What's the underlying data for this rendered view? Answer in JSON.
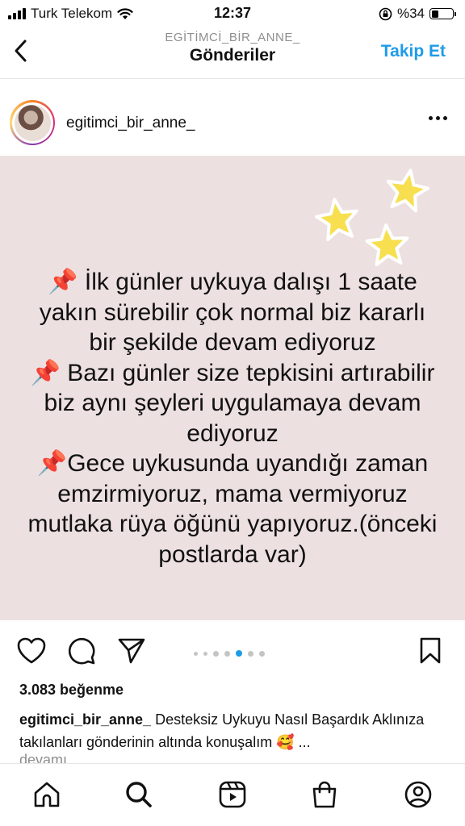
{
  "status_bar": {
    "carrier": "Turk Telekom",
    "time": "12:37",
    "battery": "%34",
    "battery_level": 0.34
  },
  "header": {
    "account": "EGİTİMCİ_BİR_ANNE_",
    "title": "Gönderiler",
    "follow_label": "Takip Et"
  },
  "post": {
    "username": "egitimci_bir_anne_",
    "text_lines": [
      "📌 İlk günler uykuya dalışı 1 saate",
      "yakın sürebilir çok normal biz kararlı",
      "bir şekilde devam ediyoruz",
      "📌 Bazı günler size tepkisini artırabilir",
      "biz aynı şeyleri uygulamaya devam",
      "ediyoruz",
      "📌Gece uykusunda uyandığı zaman",
      "emzirmiyoruz, mama vermiyoruz",
      "mutlaka rüya öğünü yapıyoruz.(önceki",
      "postlarda var)"
    ],
    "carousel": {
      "count": 7,
      "active_index": 4
    },
    "likes": "3.083 beğenme",
    "caption_user": "egitimci_bir_anne_",
    "caption_text": " Desteksiz Uykuyu Nasıl Başardık Aklınıza takılanları gönderinin altında konuşalım 🥰 ...",
    "more_label": "devamı"
  },
  "icons": {
    "back": "chevron-left-icon",
    "more": "more-horizontal-icon",
    "like": "heart-icon",
    "comment": "comment-icon",
    "share": "send-icon",
    "save": "bookmark-icon",
    "tabs": [
      "home-icon",
      "search-icon",
      "reels-icon",
      "shop-icon",
      "profile-icon"
    ]
  },
  "colors": {
    "accent": "#1e9be8",
    "post_background": "#ede0e1",
    "star": "#f7df4f"
  }
}
